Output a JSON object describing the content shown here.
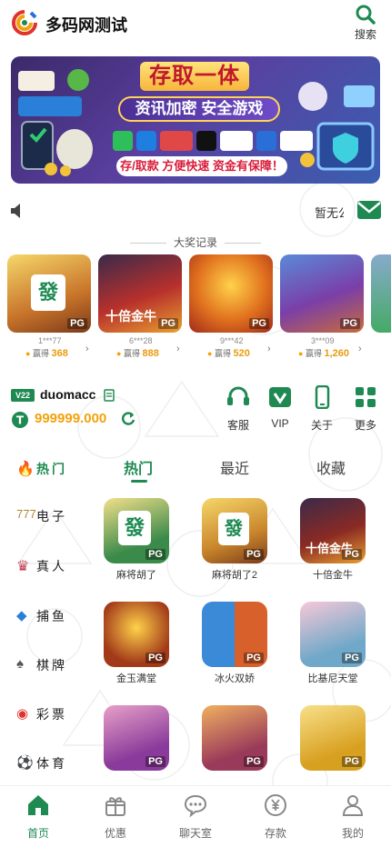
{
  "app": {
    "title": "多码网测试"
  },
  "header": {
    "search_label": "搜索"
  },
  "banner": {
    "headline": "存取一体",
    "slogan": "资讯加密 安全游戏",
    "tagline": "存/取款 方便快速 资金有保障！"
  },
  "notice": {
    "text": "暂无公告"
  },
  "jackpot": {
    "title": "大奖记录",
    "win_label": "赢得",
    "items": [
      {
        "user": "1***77",
        "amount": "368",
        "color": "#c8742a"
      },
      {
        "user": "6***28",
        "amount": "888",
        "color": "#b8302c"
      },
      {
        "user": "9***42",
        "amount": "520",
        "color": "#e0701e"
      },
      {
        "user": "3***09",
        "amount": "1,260",
        "color": "#7a3fa8"
      }
    ],
    "provider": "PG"
  },
  "account": {
    "vip_level": "V22",
    "username": "duomacc",
    "balance": "999999.000"
  },
  "quick_links": [
    {
      "label": "客服",
      "icon": "headset-icon"
    },
    {
      "label": "VIP",
      "icon": "vip-shield-icon"
    },
    {
      "label": "关于",
      "icon": "phone-icon"
    },
    {
      "label": "更多",
      "icon": "grid-icon"
    }
  ],
  "categories": [
    {
      "label": "热门",
      "icon": "flame-icon",
      "active": true
    },
    {
      "label": "电子",
      "icon": "slot-icon"
    },
    {
      "label": "真人",
      "icon": "live-dealer-icon"
    },
    {
      "label": "捕鱼",
      "icon": "fish-icon"
    },
    {
      "label": "棋牌",
      "icon": "cards-icon"
    },
    {
      "label": "彩票",
      "icon": "lottery-icon"
    },
    {
      "label": "体育",
      "icon": "soccer-icon"
    }
  ],
  "tabs": [
    {
      "label": "热门",
      "active": true
    },
    {
      "label": "最近"
    },
    {
      "label": "收藏"
    }
  ],
  "games": [
    {
      "name": "麻将胡了",
      "color": "#3a8a4a"
    },
    {
      "name": "麻将胡了2",
      "color": "#c9862c"
    },
    {
      "name": "十倍金牛",
      "color": "#8a2a24"
    },
    {
      "name": "金玉满堂",
      "color": "#a23a1a"
    },
    {
      "name": "冰火双娇",
      "color": "#d8602a"
    },
    {
      "name": "比基尼天堂",
      "color": "#6fa8c8"
    },
    {
      "name": "",
      "color": "#8a3a9a"
    },
    {
      "name": "",
      "color": "#9a3a5a"
    },
    {
      "name": "",
      "color": "#d8a020"
    }
  ],
  "bottom_nav": [
    {
      "label": "首页",
      "icon": "home-icon",
      "active": true
    },
    {
      "label": "优惠",
      "icon": "gift-icon"
    },
    {
      "label": "聊天室",
      "icon": "chat-icon"
    },
    {
      "label": "存款",
      "icon": "yuan-icon"
    },
    {
      "label": "我的",
      "icon": "user-icon"
    }
  ],
  "colors": {
    "brand": "#1e8a52",
    "gold": "#f2a20a"
  }
}
